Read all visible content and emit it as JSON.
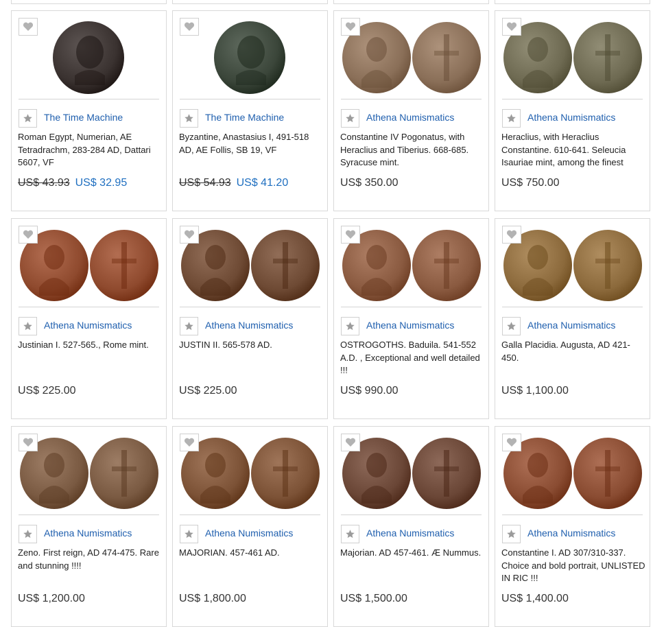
{
  "products": [
    {
      "seller": "The Time Machine",
      "title": "Roman Egypt, Numerian, AE Tetradrachm, 283-284 AD, Dattari 5607, VF",
      "old_price": "US$ 43.93",
      "price": "US$ 32.95",
      "image_kind": "single",
      "coin_color": "#3a3230"
    },
    {
      "seller": "The Time Machine",
      "title": "Byzantine, Anastasius I, 491-518 AD, AE Follis, SB 19, VF",
      "old_price": "US$ 54.93",
      "price": "US$ 41.20",
      "image_kind": "single",
      "coin_color": "#3b463a"
    },
    {
      "seller": "Athena Numismatics",
      "title": "Constantine IV Pogonatus, with Heraclius and Tiberius. 668-685. Syracuse mint.",
      "old_price": "",
      "price": "US$ 350.00",
      "image_kind": "pair",
      "coin_color": "#8a6f58"
    },
    {
      "seller": "Athena Numismatics",
      "title": "Heraclius, with Heraclius Constantine. 610-641. Seleucia Isauriae mint, among the finest",
      "old_price": "",
      "price": "US$ 750.00",
      "image_kind": "pair",
      "coin_color": "#6e6a52"
    },
    {
      "seller": "Athena Numismatics",
      "title": "Justinian I. 527-565., Rome mint.",
      "old_price": "",
      "price": "US$ 225.00",
      "image_kind": "pair",
      "coin_color": "#8f4a2e"
    },
    {
      "seller": "Athena Numismatics",
      "title": "JUSTIN II. 565-578 AD.",
      "old_price": "",
      "price": "US$ 225.00",
      "image_kind": "pair",
      "coin_color": "#6e4a34"
    },
    {
      "seller": "Athena Numismatics",
      "title": "OSTROGOTHS. Baduila. 541-552 A.D. , Exceptional and well detailed !!!",
      "old_price": "",
      "price": "US$ 990.00",
      "image_kind": "pair",
      "coin_color": "#8a5a40"
    },
    {
      "seller": "Athena Numismatics",
      "title": "Galla Placidia. Augusta, AD 421-450.",
      "old_price": "",
      "price": "US$ 1,100.00",
      "image_kind": "pair",
      "coin_color": "#8c6a3c"
    },
    {
      "seller": "Athena Numismatics",
      "title": "Zeno. First reign, AD 474-475. Rare and stunning !!!!",
      "old_price": "",
      "price": "US$ 1,200.00",
      "image_kind": "pair",
      "coin_color": "#7a5a42"
    },
    {
      "seller": "Athena Numismatics",
      "title": "MAJORIAN. 457-461 AD.",
      "old_price": "",
      "price": "US$ 1,800.00",
      "image_kind": "pair",
      "coin_color": "#7c5236"
    },
    {
      "seller": "Athena Numismatics",
      "title": "Majorian. AD 457-461. Æ Nummus.",
      "old_price": "",
      "price": "US$ 1,500.00",
      "image_kind": "pair",
      "coin_color": "#6a4636"
    },
    {
      "seller": "Athena Numismatics",
      "title": "Constantine I. AD 307/310-337. Choice and bold portrait, UNLISTED IN RIC !!!",
      "old_price": "",
      "price": "US$ 1,400.00",
      "image_kind": "pair",
      "coin_color": "#8a4c32"
    }
  ],
  "colors": {
    "seller_link": "#1f5fae",
    "sale_price": "#1f6fc0",
    "border": "#d9d9d9"
  },
  "icons": {
    "favorite": "heart-icon",
    "follow_seller": "star-icon"
  }
}
